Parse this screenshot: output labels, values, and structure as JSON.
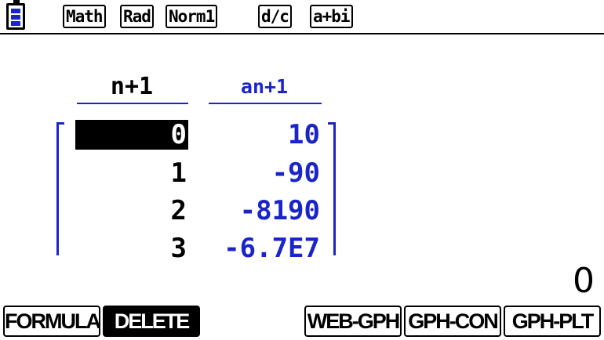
{
  "status_bar": {
    "battery_icon": "battery-icon",
    "tags": [
      "Math",
      "Rad",
      "Norm1",
      "d/c",
      "a+bi"
    ]
  },
  "table": {
    "col_n_header": "n+1",
    "col_a_header": "an+1",
    "rows": [
      {
        "n": "0",
        "a": "10"
      },
      {
        "n": "1",
        "a": "-90"
      },
      {
        "n": "2",
        "a": "-8190"
      },
      {
        "n": "3",
        "a": "-6.7E7"
      }
    ],
    "selected_row": 0
  },
  "result": "0",
  "function_keys": {
    "f1": "FORMULA",
    "f2": "DELETE",
    "f4": "WEB-GPH",
    "f5": "GPH-CON",
    "f6": "GPH-PLT"
  },
  "colors": {
    "accent_blue": "#1a24c8",
    "selection": "#000000"
  }
}
